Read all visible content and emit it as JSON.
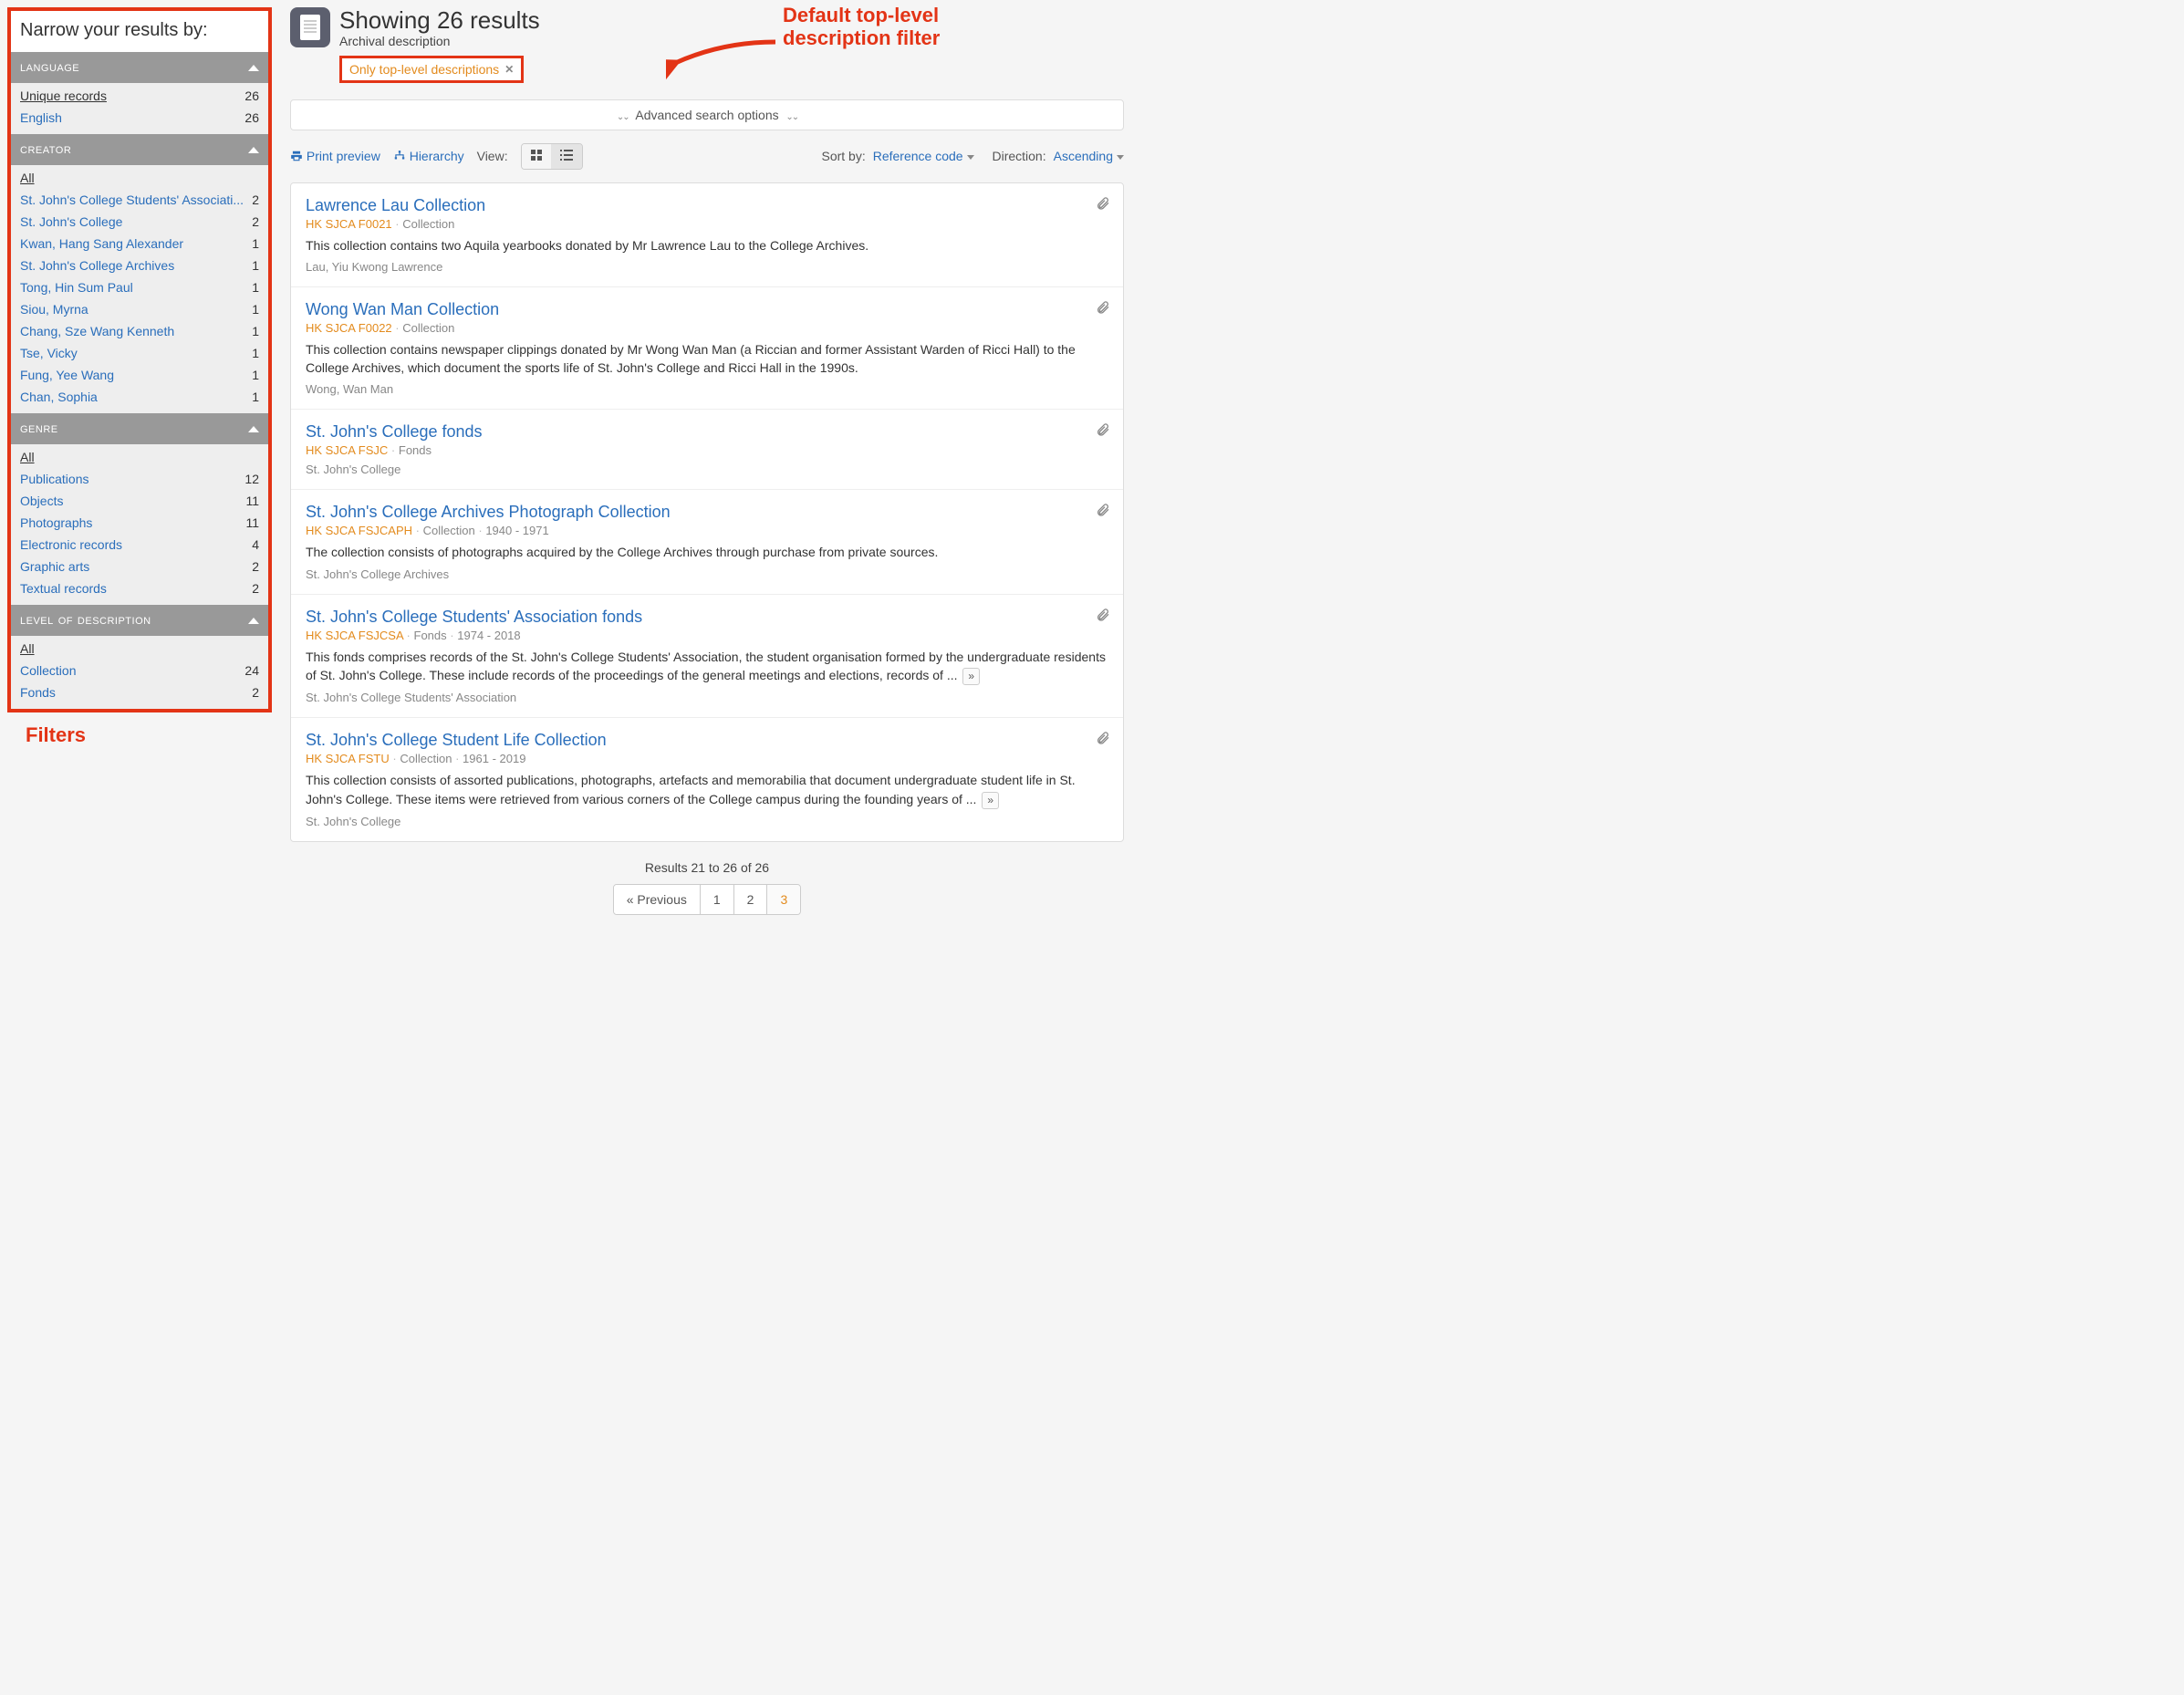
{
  "sidebar": {
    "title": "Narrow your results by:",
    "facets": [
      {
        "key": "language",
        "header": "language",
        "items": [
          {
            "label": "Unique records",
            "count": 26,
            "all": true
          },
          {
            "label": "English",
            "count": 26
          }
        ]
      },
      {
        "key": "creator",
        "header": "creator",
        "items": [
          {
            "label": "All",
            "all": true
          },
          {
            "label": "St. John's College Students' Associati...",
            "count": 2
          },
          {
            "label": "St. John's College",
            "count": 2
          },
          {
            "label": "Kwan, Hang Sang Alexander",
            "count": 1
          },
          {
            "label": "St. John's College Archives",
            "count": 1
          },
          {
            "label": "Tong, Hin Sum Paul",
            "count": 1
          },
          {
            "label": "Siou, Myrna",
            "count": 1
          },
          {
            "label": "Chang, Sze Wang Kenneth",
            "count": 1
          },
          {
            "label": "Tse, Vicky",
            "count": 1
          },
          {
            "label": "Fung, Yee Wang",
            "count": 1
          },
          {
            "label": "Chan, Sophia",
            "count": 1
          }
        ]
      },
      {
        "key": "genre",
        "header": "genre",
        "items": [
          {
            "label": "All",
            "all": true
          },
          {
            "label": "Publications",
            "count": 12
          },
          {
            "label": "Objects",
            "count": 11
          },
          {
            "label": "Photographs",
            "count": 11
          },
          {
            "label": "Electronic records",
            "count": 4
          },
          {
            "label": "Graphic arts",
            "count": 2
          },
          {
            "label": "Textual records",
            "count": 2
          }
        ]
      },
      {
        "key": "level",
        "header": "level of description",
        "items": [
          {
            "label": "All",
            "all": true
          },
          {
            "label": "Collection",
            "count": 24
          },
          {
            "label": "Fonds",
            "count": 2
          }
        ]
      }
    ]
  },
  "annotations": {
    "filters_caption": "Filters",
    "top_filter_callout_l1": "Default top-level",
    "top_filter_callout_l2": "description filter"
  },
  "header": {
    "title": "Showing 26 results",
    "subtitle": "Archival description"
  },
  "top_filter_chip": {
    "label": "Only top-level descriptions",
    "close_glyph": "✕"
  },
  "advanced_bar": {
    "label": "Advanced search options"
  },
  "toolbar": {
    "print_preview": "Print preview",
    "hierarchy": "Hierarchy",
    "view_label": "View:",
    "sort_by_label": "Sort by:",
    "sort_by_value": "Reference code",
    "direction_label": "Direction:",
    "direction_value": "Ascending"
  },
  "results": [
    {
      "title": "Lawrence Lau Collection",
      "ref": "HK SJCA F0021",
      "level": "Collection",
      "dates": "",
      "desc": "This collection contains two Aquila yearbooks donated by Mr Lawrence Lau to the College Archives.",
      "creator": "Lau, Yiu Kwong Lawrence",
      "more": false
    },
    {
      "title": "Wong Wan Man Collection",
      "ref": "HK SJCA F0022",
      "level": "Collection",
      "dates": "",
      "desc": "This collection contains newspaper clippings donated by Mr Wong Wan Man (a Riccian and former Assistant Warden of Ricci Hall) to the College Archives, which document the sports life of St. John's College and Ricci Hall in the 1990s.",
      "creator": "Wong, Wan Man",
      "more": false
    },
    {
      "title": "St. John's College fonds",
      "ref": "HK SJCA FSJC",
      "level": "Fonds",
      "dates": "",
      "desc": "",
      "creator": "St. John's College",
      "more": false
    },
    {
      "title": "St. John's College Archives Photograph Collection",
      "ref": "HK SJCA FSJCAPH",
      "level": "Collection",
      "dates": "1940 - 1971",
      "desc": "The collection consists of photographs acquired by the College Archives through purchase from private sources.",
      "creator": "St. John's College Archives",
      "more": false
    },
    {
      "title": "St. John's College Students' Association fonds",
      "ref": "HK SJCA FSJCSA",
      "level": "Fonds",
      "dates": "1974 - 2018",
      "desc": "This fonds comprises records of the St. John's College Students' Association, the student organisation formed by the undergraduate residents of St. John's College. These include records of the proceedings of the general meetings and elections, records of ...",
      "creator": "St. John's College Students' Association",
      "more": true
    },
    {
      "title": "St. John's College Student Life Collection",
      "ref": "HK SJCA FSTU",
      "level": "Collection",
      "dates": "1961 - 2019",
      "desc": "This collection consists of assorted publications, photographs, artefacts and memorabilia that document undergraduate student life in St. John's College. These items were retrieved from various corners of the College campus during the founding years of ...",
      "creator": "St. John's College",
      "more": true
    }
  ],
  "pager": {
    "summary": "Results 21 to 26 of 26",
    "prev_label": "« Previous",
    "pages": [
      "1",
      "2",
      "3"
    ],
    "current": "3"
  }
}
